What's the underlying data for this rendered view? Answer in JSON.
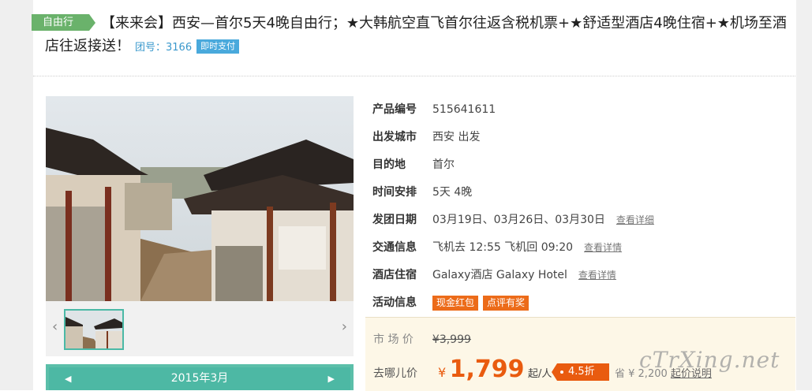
{
  "header": {
    "tag": "自由行",
    "title": "【来来会】西安—首尔5天4晚自由行；★大韩航空直飞首尔往返含税机票+★舒适型酒店4晚住宿+★机场至酒店往返接送！",
    "tour_no": "团号：3166",
    "pay_badge": "即时支付"
  },
  "gallery": {
    "prev_icon": "‹",
    "next_icon": "›",
    "calendar": {
      "month": "2015年3月",
      "prev_icon": "◀",
      "next_icon": "▶"
    }
  },
  "info": {
    "rows": [
      {
        "label": "产品编号",
        "value": "515641611"
      },
      {
        "label": "出发城市",
        "value": "西安 出发"
      },
      {
        "label": "目的地",
        "value": "首尔"
      },
      {
        "label": "时间安排",
        "value": "5天 4晚"
      },
      {
        "label": "发团日期",
        "value": "03月19日、03月26日、03月30日",
        "link": "查看详细"
      },
      {
        "label": "交通信息",
        "value": "飞机去 12:55 飞机回 09:20",
        "link": "查看详情"
      },
      {
        "label": "酒店住宿",
        "value": "Galaxy酒店 Galaxy Hotel",
        "link": "查看详情"
      },
      {
        "label": "活动信息",
        "badges": [
          "现金红包",
          "点评有奖"
        ]
      }
    ]
  },
  "price": {
    "market_label": "市 场 价",
    "market_price": "¥3,999",
    "qunar_label": "去哪儿价",
    "currency": "¥",
    "price": "1,799",
    "per": "起/人",
    "discount": "4.5折",
    "save_text": "省 ¥ 2,200",
    "price_note_link": "起价说明"
  },
  "watermark": "cTrXing.net",
  "colors": {
    "accent_green": "#6ab26b",
    "teal": "#4db8a4",
    "orange": "#e95b0f",
    "blue": "#3a98cc"
  }
}
